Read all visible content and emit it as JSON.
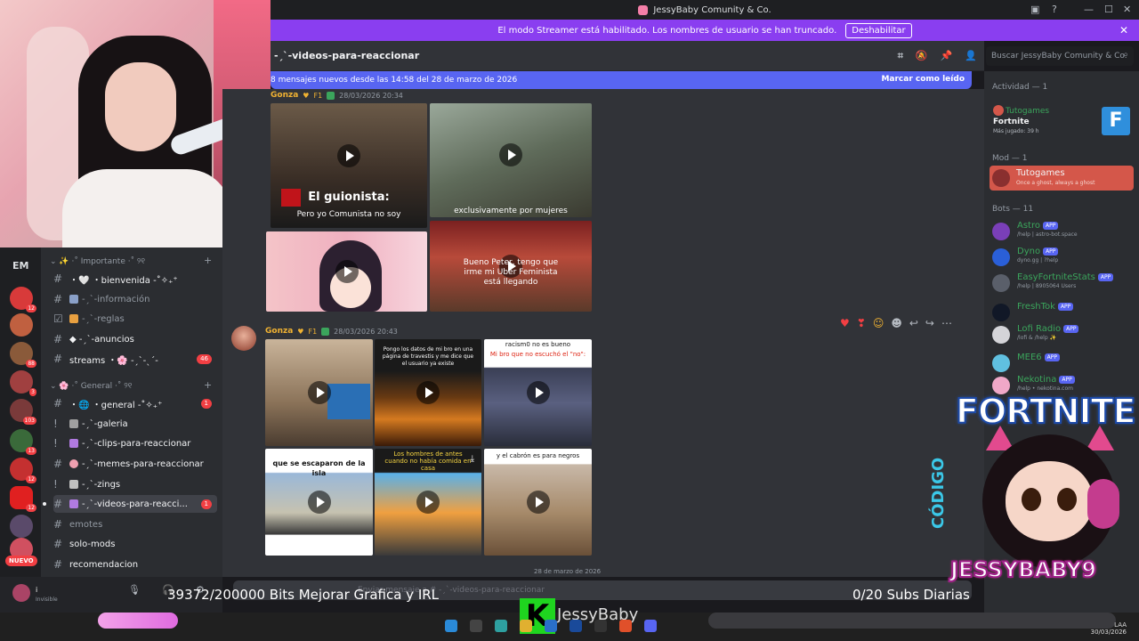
{
  "window": {
    "title": "JessyBaby Comunity & Co."
  },
  "banner": {
    "text": "El modo Streamer está habilitado. Los nombres de usuario se han truncado.",
    "button": "Deshabilitar"
  },
  "channel": {
    "name": "-ˏˋ-videos-para-reaccionar",
    "search_placeholder": "Buscar JessyBaby Comunity & Co."
  },
  "new_messages": {
    "text": "8 mensajes nuevos desde las 14:58 del 28 de marzo de 2026",
    "mark_read": "Marcar como leído"
  },
  "messages": [
    {
      "author": "Gonza",
      "badge": "F1",
      "time": "28/03/2026 20:34",
      "captions": [
        "El guionista:",
        "Pero yo Comunista no soy",
        "exclusivamente por mujeres",
        "Bueno Peter, tengo que irme mi Uber Feminista está llegando"
      ]
    },
    {
      "author": "Gonza",
      "badge": "F1",
      "time": "28/03/2026 20:43",
      "captions": [
        "Pongo los datos de mi bro en una página de travestis y me dice que el usuario ya existe",
        "racism0 no es bueno",
        "Mi bro que no escuchó el \"no\":",
        "que se escaparon de la isla",
        "Los hombres de antes cuando no había comida en casa",
        "y el cabrón es para negros"
      ]
    }
  ],
  "date_separator": "28 de marzo de 2026",
  "guild": {
    "short": "EM",
    "badges": [
      "12",
      "88",
      "3",
      "103",
      "13",
      "12",
      "12"
    ],
    "nuevo": "NUEVO"
  },
  "categories": [
    {
      "label": "✨ ·˚ Importante ·˚ ୨୧"
    },
    {
      "label": "🌸 ·˚ General ·˚ ୨୧"
    }
  ],
  "channels": [
    {
      "label": "・🤍 ・bienvenida -˚✧₊⁺",
      "kind": "#",
      "unread": ""
    },
    {
      "label": "-ˏˋ-información",
      "kind": "!",
      "unread": ""
    },
    {
      "label": "-ˏˋ-reglas",
      "kind": "☑",
      "unread": ""
    },
    {
      "label": "◆ -ˏˋ-anuncios",
      "kind": "#",
      "unread": ""
    },
    {
      "label": "streams ・🌸 -ˏˋ-ˎˊ-",
      "kind": "#",
      "unread": "46"
    },
    {
      "label": "・🌐 ・general -˚✧₊⁺",
      "kind": "#",
      "unread": "1"
    },
    {
      "label": "-ˏˋ-galeria",
      "kind": "!",
      "unread": ""
    },
    {
      "label": "-ˏˋ-clips-para-reaccionar",
      "kind": "!",
      "unread": ""
    },
    {
      "label": "-ˏˋ-memes-para-reaccionar",
      "kind": "#",
      "unread": ""
    },
    {
      "label": "-ˏˋ-zings",
      "kind": "!",
      "unread": ""
    },
    {
      "label": "-ˏˋ-videos-para-reacci...",
      "kind": "#",
      "unread": "1"
    },
    {
      "label": "emotes",
      "kind": "#",
      "unread": ""
    },
    {
      "label": "solo-mods",
      "kind": "#",
      "unread": ""
    },
    {
      "label": "recomendacion",
      "kind": "#",
      "unread": ""
    }
  ],
  "user": {
    "name": "i",
    "status": "Invisible"
  },
  "input_placeholder": "Enviar mensaje a # -ˏˋ-videos-para-reaccionar",
  "members": {
    "activity_header": "Actividad — 1",
    "activity": {
      "name": "Tutogames",
      "game": "Fortnite",
      "played": "Más jugado: 39 h",
      "tile": "F"
    },
    "mod_header": "Mod — 1",
    "mod": {
      "name": "Tutogames",
      "sub": "Once a ghost, always a ghost"
    },
    "bots_header": "Bots — 11",
    "bots": [
      {
        "name": "Astro",
        "sub": "/help | astro-bot.space",
        "color": "#9b59b6"
      },
      {
        "name": "Dyno",
        "sub": "dyno.gg | ?help",
        "color": "#3b82f6"
      },
      {
        "name": "EasyFortniteStats",
        "sub": "/help | 8905064 Users",
        "color": "#6b7280"
      },
      {
        "name": "FreshTok",
        "sub": "",
        "color": "#111827"
      },
      {
        "name": "Lofi Radio",
        "sub": "/lofi & /help ✨",
        "color": "#e5e7eb"
      },
      {
        "name": "MEE6",
        "sub": "",
        "color": "#60a5fa"
      },
      {
        "name": "Nekotina",
        "sub": "/help • nekotina.com",
        "color": "#f9a8d4"
      }
    ],
    "app_label": "APP"
  },
  "overlay": {
    "bits": "39372/200000 Bits Mejorar Grafica y IRL",
    "subs": "0/20 Subs Diarias",
    "kick_letter": "K",
    "kick_name": "JessyBaby",
    "fortnite": "FORTNITE",
    "codigo": "CÓDIGO",
    "logo": "JESSYBABY9"
  },
  "tray": {
    "lang": "LAA",
    "date": "30/03/2026"
  }
}
